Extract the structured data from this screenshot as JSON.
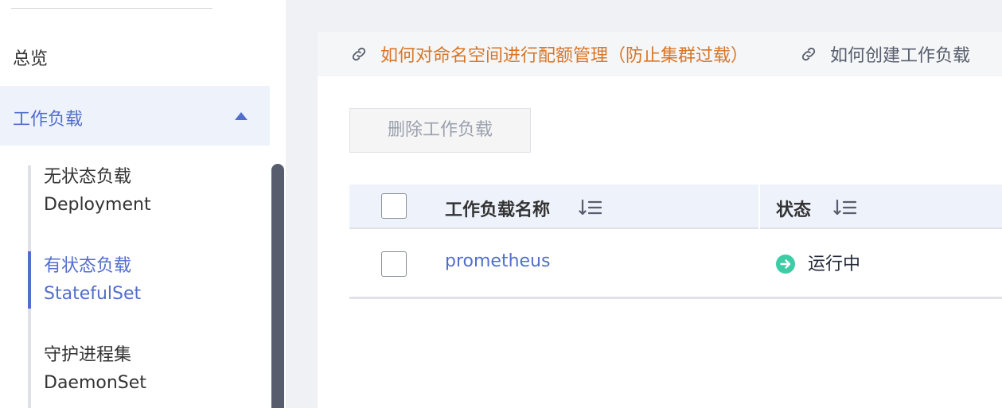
{
  "sidebar": {
    "overview_label": "总览",
    "workload_label": "工作负载",
    "items": [
      {
        "label_cn": "无状态负载",
        "label_en": "Deployment",
        "active": false
      },
      {
        "label_cn": "有状态负载",
        "label_en": "StatefulSet",
        "active": true
      },
      {
        "label_cn": "守护进程集",
        "label_en": "DaemonSet",
        "active": false
      }
    ]
  },
  "tips": [
    {
      "text": "如何对命名空间进行配额管理（防止集群过载）"
    },
    {
      "text": "如何创建工作负载"
    }
  ],
  "toolbar": {
    "delete_label": "删除工作负载"
  },
  "table": {
    "columns": [
      {
        "label": "工作负载名称"
      },
      {
        "label": "状态"
      }
    ],
    "rows": [
      {
        "name": "prometheus",
        "status": "运行中"
      }
    ]
  },
  "colors": {
    "accent": "#526ecc",
    "tip_warning": "#d87627",
    "status_running": "#3dcca6",
    "scrollbar": "#575d6c"
  }
}
